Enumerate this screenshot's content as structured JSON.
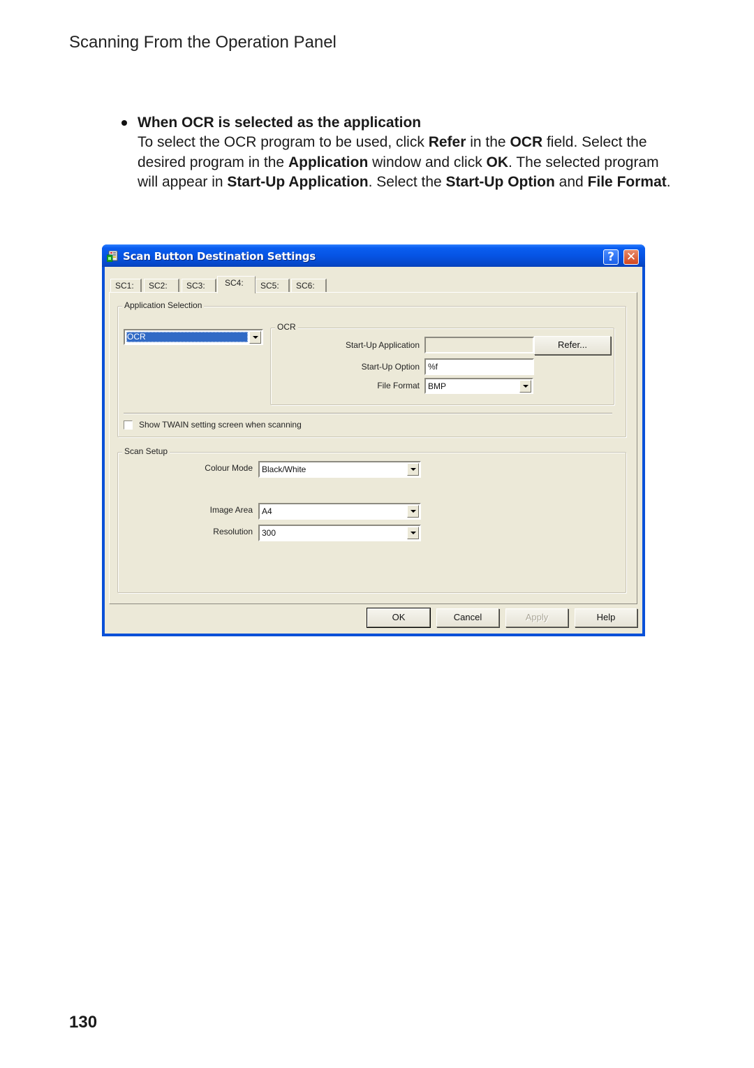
{
  "page": {
    "header": "Scanning From the Operation Panel",
    "section_title": "When OCR is selected as the application",
    "body_segments": [
      {
        "text": "To select the OCR program to be used, click ",
        "bold": false
      },
      {
        "text": "Refer",
        "bold": true
      },
      {
        "text": " in the ",
        "bold": false
      },
      {
        "text": "OCR",
        "bold": true
      },
      {
        "text": " field. Select the desired program in the ",
        "bold": false
      },
      {
        "text": "Application",
        "bold": true
      },
      {
        "text": " window and click ",
        "bold": false
      },
      {
        "text": "OK",
        "bold": true
      },
      {
        "text": ". The selected program will appear in ",
        "bold": false
      },
      {
        "text": "Start-Up Application",
        "bold": true
      },
      {
        "text": ". Select the ",
        "bold": false
      },
      {
        "text": "Start-Up Option",
        "bold": true
      },
      {
        "text": " and ",
        "bold": false
      },
      {
        "text": "File Format",
        "bold": true
      },
      {
        "text": ".",
        "bold": false
      }
    ],
    "page_number": "130"
  },
  "dialog": {
    "title": "Scan Button Destination Settings",
    "help_button": "?",
    "close_button": "✕",
    "tabs": [
      {
        "label": "SC1:",
        "active": false
      },
      {
        "label": "SC2:",
        "active": false
      },
      {
        "label": "SC3:",
        "active": false
      },
      {
        "label": "SC4:",
        "active": true
      },
      {
        "label": "SC5:",
        "active": false
      },
      {
        "label": "SC6:",
        "active": false
      }
    ],
    "application_selection": {
      "label": "Application Selection",
      "selected_value": "OCR",
      "ocr_group": {
        "label": "OCR",
        "startup_application_label": "Start-Up Application",
        "startup_application_value": "",
        "refer_button": "Refer...",
        "startup_option_label": "Start-Up Option",
        "startup_option_value": "%f",
        "file_format_label": "File Format",
        "file_format_value": "BMP"
      },
      "show_twain_checkbox": {
        "label": "Show TWAIN setting screen when scanning",
        "checked": false
      }
    },
    "scan_setup": {
      "label": "Scan Setup",
      "colour_mode_label": "Colour Mode",
      "colour_mode_value": "Black/White",
      "image_area_label": "Image Area",
      "image_area_value": "A4",
      "resolution_label": "Resolution",
      "resolution_value": "300"
    },
    "buttons": {
      "ok": "OK",
      "cancel": "Cancel",
      "apply": "Apply",
      "help": "Help"
    }
  }
}
